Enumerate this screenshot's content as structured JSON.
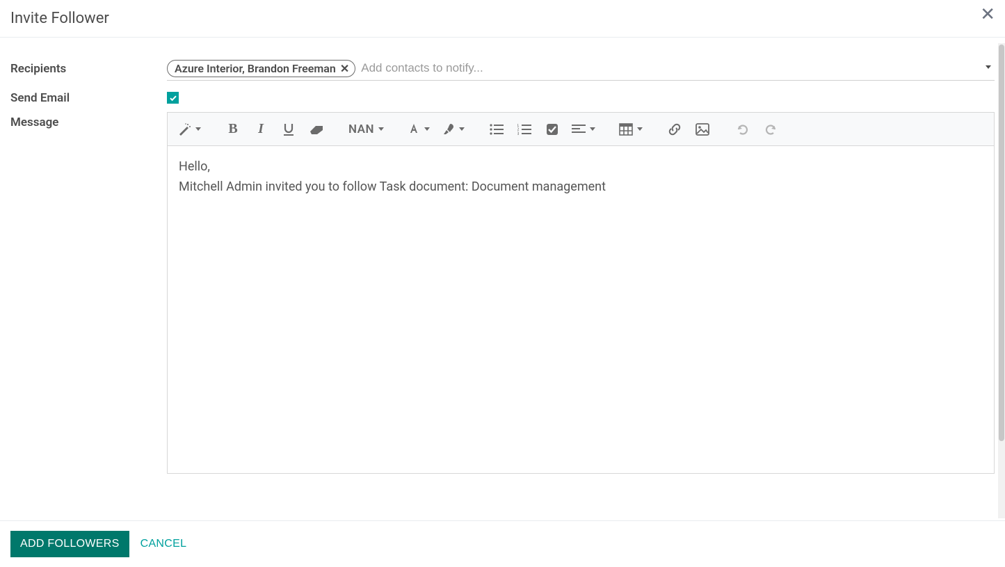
{
  "modal": {
    "title": "Invite Follower"
  },
  "labels": {
    "recipients": "Recipients",
    "send_email": "Send Email",
    "message": "Message"
  },
  "recipients": {
    "tags": [
      {
        "label": "Azure Interior, Brandon Freeman"
      }
    ],
    "placeholder": "Add contacts to notify..."
  },
  "send_email": {
    "checked": true
  },
  "toolbar": {
    "font_size_label": "NAN"
  },
  "message": {
    "line1": "Hello,",
    "line2": "Mitchell Admin invited you to follow Task document: Document management"
  },
  "footer": {
    "add_followers": "ADD FOLLOWERS",
    "cancel": "CANCEL"
  }
}
